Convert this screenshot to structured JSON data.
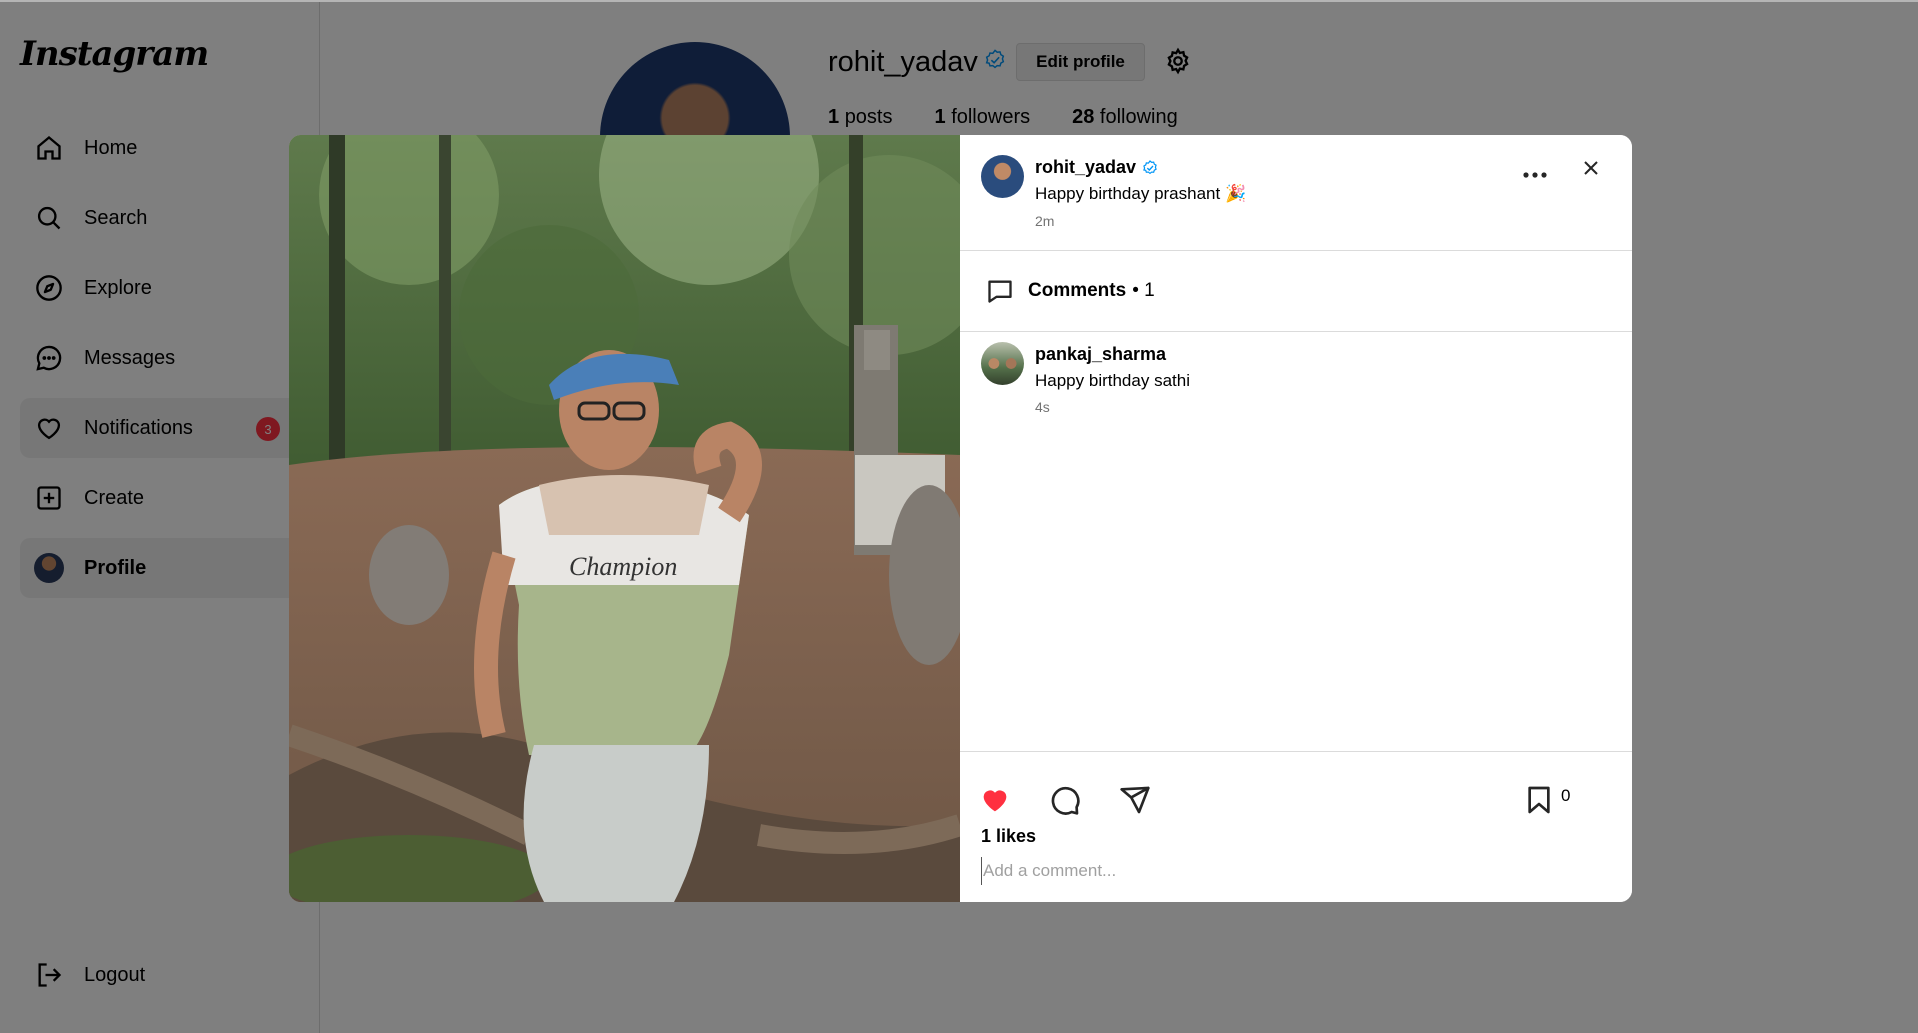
{
  "sidebar": {
    "logo": "Instagram",
    "items": [
      {
        "label": "Home"
      },
      {
        "label": "Search"
      },
      {
        "label": "Explore"
      },
      {
        "label": "Messages"
      },
      {
        "label": "Notifications",
        "badge": "3"
      },
      {
        "label": "Create"
      },
      {
        "label": "Profile"
      }
    ],
    "logout": "Logout"
  },
  "profile": {
    "username": "rohit_yadav",
    "edit_label": "Edit profile",
    "stats": {
      "posts_count": "1",
      "posts_label": "posts",
      "followers_count": "1",
      "followers_label": "followers",
      "following_count": "28",
      "following_label": "following"
    }
  },
  "post": {
    "author": "rohit_yadav",
    "caption": "Happy birthday prashant 🎉",
    "time": "2m",
    "comments_label": "Comments",
    "comments_count": "• 1",
    "comments": [
      {
        "user": "pankaj_sharma",
        "text": "Happy birthday sathi",
        "time": "4s"
      }
    ],
    "likes": "1 likes",
    "saves": "0",
    "comment_placeholder": "Add a comment..."
  },
  "colors": {
    "like": "#ff3040",
    "verified": "#0095f6",
    "badge": "#ff3040"
  }
}
